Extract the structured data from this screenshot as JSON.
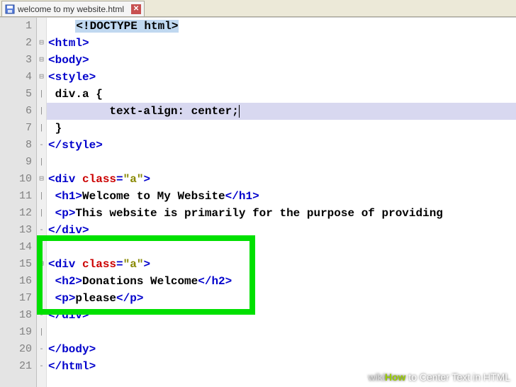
{
  "tab": {
    "filename": "welcome to my website.html"
  },
  "lines": [
    {
      "n": 1,
      "fold": "",
      "tokens": [
        [
          "pad4",
          ""
        ],
        [
          "doctype",
          "<!DOCTYPE html>"
        ]
      ]
    },
    {
      "n": 2,
      "fold": "⊟",
      "tokens": [
        [
          "tag",
          "<html>"
        ]
      ]
    },
    {
      "n": 3,
      "fold": "⊟",
      "tokens": [
        [
          "tag",
          "<body>"
        ]
      ]
    },
    {
      "n": 4,
      "fold": "⊟",
      "tokens": [
        [
          "tag",
          "<style>"
        ]
      ]
    },
    {
      "n": 5,
      "fold": "|",
      "tokens": [
        [
          "pad1",
          ""
        ],
        [
          "txt",
          "div.a {"
        ]
      ]
    },
    {
      "n": 6,
      "fold": "|",
      "curr": true,
      "tokens": [
        [
          "pad9",
          ""
        ],
        [
          "txt",
          "text-align: center;"
        ],
        [
          "caret",
          ""
        ]
      ]
    },
    {
      "n": 7,
      "fold": "|",
      "tokens": [
        [
          "pad1",
          ""
        ],
        [
          "txt",
          "}"
        ]
      ]
    },
    {
      "n": 8,
      "fold": "-",
      "tokens": [
        [
          "tag",
          "</style>"
        ]
      ]
    },
    {
      "n": 9,
      "fold": "|",
      "tokens": []
    },
    {
      "n": 10,
      "fold": "⊟",
      "tokens": [
        [
          "tag",
          "<div "
        ],
        [
          "attr",
          "class"
        ],
        [
          "tag",
          "="
        ],
        [
          "val",
          "\"a\""
        ],
        [
          "tag",
          ">"
        ]
      ]
    },
    {
      "n": 11,
      "fold": "|",
      "tokens": [
        [
          "pad1",
          ""
        ],
        [
          "tag",
          "<h1>"
        ],
        [
          "txt",
          "Welcome to My Website"
        ],
        [
          "tag",
          "</h1>"
        ]
      ]
    },
    {
      "n": 12,
      "fold": "|",
      "tokens": [
        [
          "pad1",
          ""
        ],
        [
          "tag",
          "<p>"
        ],
        [
          "txt",
          "This website is primarily for the purpose of providing"
        ]
      ]
    },
    {
      "n": 13,
      "fold": "-",
      "tokens": [
        [
          "tag",
          "</div>"
        ]
      ]
    },
    {
      "n": 14,
      "fold": "|",
      "tokens": []
    },
    {
      "n": 15,
      "fold": "⊟",
      "tokens": [
        [
          "tag",
          "<div "
        ],
        [
          "attr",
          "class"
        ],
        [
          "tag",
          "="
        ],
        [
          "val",
          "\"a\""
        ],
        [
          "tag",
          ">"
        ]
      ]
    },
    {
      "n": 16,
      "fold": "|",
      "tokens": [
        [
          "pad1",
          ""
        ],
        [
          "tag",
          "<h2>"
        ],
        [
          "txt",
          "Donations Welcome"
        ],
        [
          "tag",
          "</h2>"
        ]
      ]
    },
    {
      "n": 17,
      "fold": "|",
      "tokens": [
        [
          "pad1",
          ""
        ],
        [
          "tag",
          "<p>"
        ],
        [
          "txt",
          "please"
        ],
        [
          "tag",
          "</p>"
        ]
      ]
    },
    {
      "n": 18,
      "fold": "-",
      "tokens": [
        [
          "tag",
          "</div>"
        ]
      ]
    },
    {
      "n": 19,
      "fold": "|",
      "tokens": []
    },
    {
      "n": 20,
      "fold": "-",
      "tokens": [
        [
          "tag",
          "</body>"
        ]
      ]
    },
    {
      "n": 21,
      "fold": "-",
      "tokens": [
        [
          "tag",
          "</html>"
        ]
      ]
    }
  ],
  "watermark": {
    "wiki": "wiki",
    "how": "How",
    "rest": " to Center Text in HTML"
  }
}
